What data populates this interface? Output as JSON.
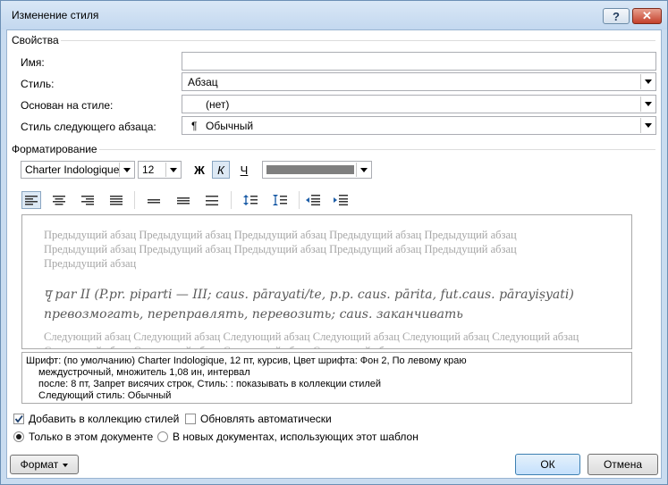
{
  "window": {
    "title": "Изменение стиля",
    "help_label": "?",
    "close_label": "✕"
  },
  "properties": {
    "section_label": "Свойства",
    "name_label": "Имя:",
    "name_value": "",
    "style_type_label": "Стиль:",
    "style_type_value": "Абзац",
    "based_on_label": "Основан на стиле:",
    "based_on_value": "(нет)",
    "next_style_label": "Стиль следующего абзаца:",
    "next_style_value": "Обычный",
    "next_style_icon": "¶"
  },
  "formatting": {
    "section_label": "Форматирование",
    "font_name": "Charter Indologique",
    "font_size": "12",
    "bold_label": "Ж",
    "italic_label": "К",
    "underline_label": "Ч",
    "color_swatch": "#7f7f7f"
  },
  "preview": {
    "previous_para": "Предыдущий абзац Предыдущий абзац Предыдущий абзац Предыдущий абзац Предыдущий абзац Предыдущий абзац Предыдущий абзац Предыдущий абзац Предыдущий абзац Предыдущий абзац Предыдущий абзац",
    "main_line1": "पृ par II (P.pr. piparti — III; caus. pārayati/te, p.p. caus. pārita, fut.caus. pārayiṣyati)",
    "main_line2": "превозмогать, переправлять, перевозить; caus. заканчивать",
    "next_para": "Следующий абзац Следующий абзац Следующий абзац Следующий абзац Следующий абзац Следующий абзац Следующий абзац Следующий абзац Следующий абзац Следующий абзац"
  },
  "description": {
    "line1": "Шрифт: (по умолчанию) Charter Indologique, 12 пт, курсив, Цвет шрифта: Фон 2, По левому краю",
    "line2": "междустрочный,  множитель 1,08 ин, интервал",
    "line3": "после: 8 пт, Запрет висячих строк, Стиль: : показывать в коллекции стилей",
    "line4": "Следующий стиль: Обычный"
  },
  "options": {
    "add_to_gallery": "Добавить в коллекцию стилей",
    "auto_update": "Обновлять автоматически",
    "only_this_doc": "Только в этом документе",
    "new_docs": "В новых документах, использующих этот шаблон"
  },
  "buttons": {
    "format": "Формат",
    "ok": "ОК",
    "cancel": "Отмена"
  }
}
